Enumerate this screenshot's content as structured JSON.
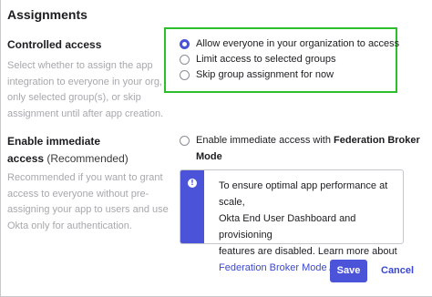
{
  "section": {
    "title": "Assignments"
  },
  "controlled_access": {
    "label": "Controlled access",
    "description_lines": [
      "Select whether to assign the app",
      "integration to everyone in your org,",
      "only selected group(s), or skip",
      "assignment until after app creation."
    ],
    "options": [
      {
        "label": "Allow everyone in your organization to access",
        "selected": true
      },
      {
        "label": "Limit access to selected groups",
        "selected": false
      },
      {
        "label": "Skip group assignment for now",
        "selected": false
      }
    ]
  },
  "immediate_access": {
    "label_line1": "Enable immediate",
    "label_line2": "access",
    "label_suffix": "(Recommended)",
    "description_lines": [
      "Recommended if you want to grant",
      "access to everyone without pre-",
      "assigning your app to users and use",
      "Okta only for authentication."
    ],
    "checkbox_prefix": "Enable immediate access with",
    "checkbox_bold": "Federation Broker",
    "checkbox_line2": "Mode",
    "checked": false
  },
  "callout": {
    "icon": "info-icon",
    "lines": [
      "To ensure optimal app performance at scale,",
      "Okta End User Dashboard and provisioning",
      "features are disabled. Learn more about"
    ],
    "link_text": "Federation Broker Mode",
    "link_suffix": "."
  },
  "actions": {
    "save_label": "Save",
    "cancel_label": "Cancel"
  },
  "colors": {
    "accent": "#4b54d8",
    "highlight": "#2bc02b",
    "muted_text": "#a8a8ad"
  }
}
